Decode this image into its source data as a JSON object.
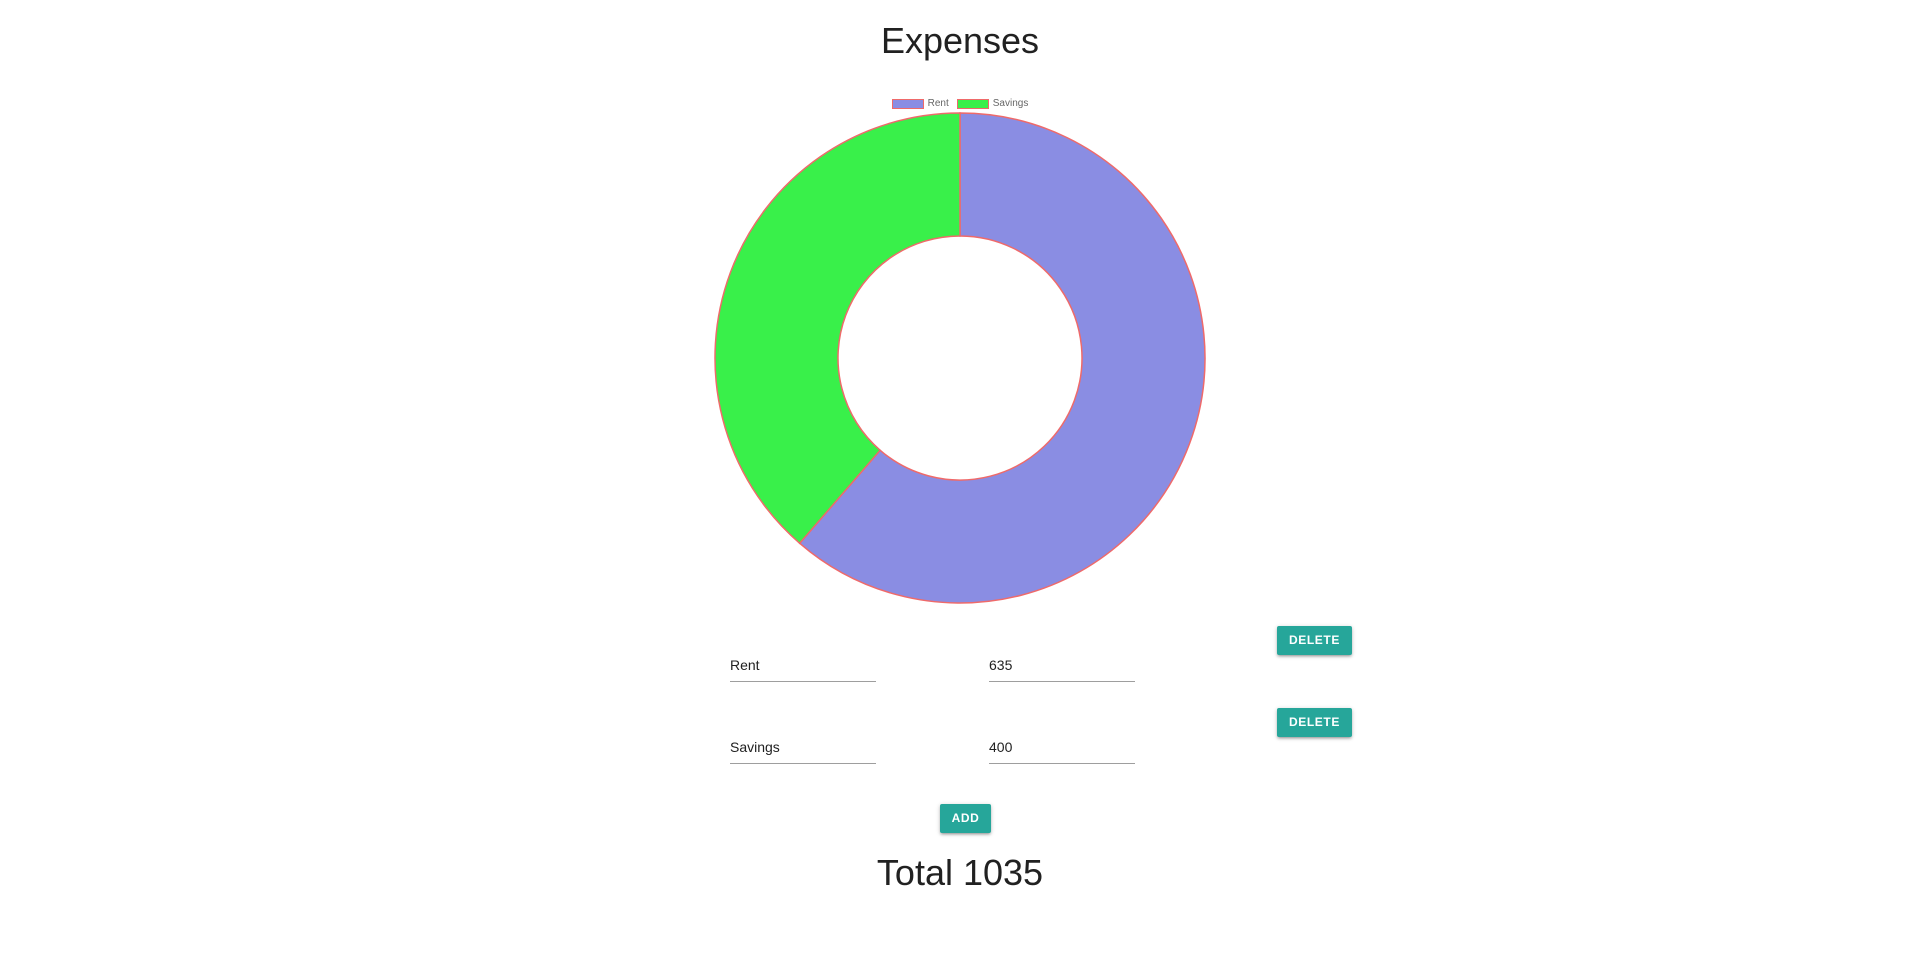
{
  "page": {
    "title": "Expenses"
  },
  "chart_data": {
    "type": "doughnut",
    "labels": [
      "Rent",
      "Savings"
    ],
    "values": [
      635,
      400
    ],
    "colors": [
      "#8a8de3",
      "#39f04a"
    ],
    "border_color": "#ef6a6a",
    "legend_position": "top"
  },
  "expenses": [
    {
      "name": "Rent",
      "amount": "635",
      "delete_label": "DELETE"
    },
    {
      "name": "Savings",
      "amount": "400",
      "delete_label": "DELETE"
    }
  ],
  "actions": {
    "add_label": "ADD"
  },
  "summary": {
    "total_text": "Total 1035"
  },
  "theme": {
    "button_color": "#26a69a"
  }
}
